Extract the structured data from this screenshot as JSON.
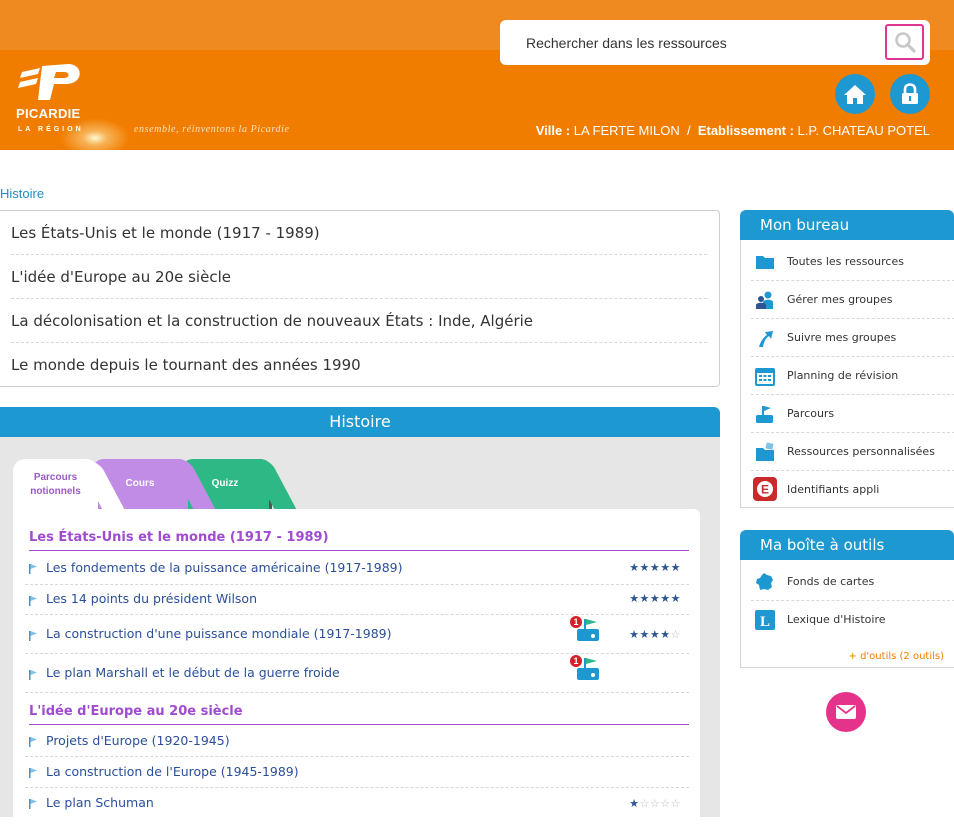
{
  "header": {
    "logo_name": "PICARDIE",
    "logo_sub": "LA RÉGION",
    "tagline": "ensemble, réinventons la Picardie",
    "search": {
      "placeholder": "Rechercher dans les ressources"
    },
    "location": {
      "ville_label": "Ville :",
      "ville": "LA FERTE MILON",
      "sep": "/",
      "etab_label": "Etablissement :",
      "etab": "L.P. CHATEAU POTEL"
    },
    "colors": {
      "orange": "#f07d00",
      "blue": "#1e98d0",
      "pink": "#e5338b"
    },
    "icons": [
      "search-icon",
      "home-icon",
      "lock-icon"
    ]
  },
  "breadcrumb": "Histoire",
  "chapters": [
    "Les États-Unis et le monde (1917 - 1989)",
    "L'idée d'Europe au 20e siècle",
    "La décolonisation et la construction de nouveaux États : Inde, Algérie",
    "Le monde depuis le tournant des années 1990"
  ],
  "panel": {
    "title": "Histoire",
    "tabs": {
      "parcours": "Parcours notionnels",
      "cours": "Cours",
      "quizz": "Quizz"
    },
    "sections": [
      {
        "title": "Les États-Unis et le monde (1917 - 1989)",
        "lessons": [
          {
            "label": "Les fondements de la puissance américaine (1917-1989)",
            "stars": "★★★★★",
            "empty": "",
            "badge": ""
          },
          {
            "label": "Les 14 points du président Wilson",
            "stars": "★★★★★",
            "empty": "",
            "badge": ""
          },
          {
            "label": "La construction d'une puissance mondiale (1917-1989)",
            "stars": "★★★★",
            "empty": "☆",
            "badge": "1"
          },
          {
            "label": "Le plan Marshall et le début de la guerre froide",
            "stars": "",
            "empty": "",
            "badge": "1"
          }
        ]
      },
      {
        "title": "L'idée d'Europe au 20e siècle",
        "lessons": [
          {
            "label": "Projets d'Europe (1920-1945)",
            "stars": "",
            "empty": "",
            "badge": ""
          },
          {
            "label": "La construction de l'Europe (1945-1989)",
            "stars": "",
            "empty": "",
            "badge": ""
          },
          {
            "label": "Le plan Schuman",
            "stars": "★",
            "empty": "☆☆☆☆",
            "badge": ""
          }
        ]
      }
    ]
  },
  "mon_bureau": {
    "title": "Mon bureau",
    "items": [
      {
        "label": "Toutes les ressources",
        "icon": "folder-icon"
      },
      {
        "label": "Gérer mes groupes",
        "icon": "group-icon"
      },
      {
        "label": "Suivre mes groupes",
        "icon": "arrow-up-icon"
      },
      {
        "label": "Planning de révision",
        "icon": "calendar-icon"
      },
      {
        "label": "Parcours",
        "icon": "parcours-icon"
      },
      {
        "label": "Ressources personnalisées",
        "icon": "custom-resources-icon"
      },
      {
        "label": "Identifiants appli",
        "icon": "app-e-icon"
      }
    ]
  },
  "boite_outils": {
    "title": "Ma boîte à outils",
    "items": [
      {
        "label": "Fonds de cartes",
        "icon": "france-map-icon"
      },
      {
        "label": "Lexique d'Histoire",
        "icon": "lexique-l-icon"
      }
    ],
    "more": "+ d'outils (2 outils)"
  }
}
